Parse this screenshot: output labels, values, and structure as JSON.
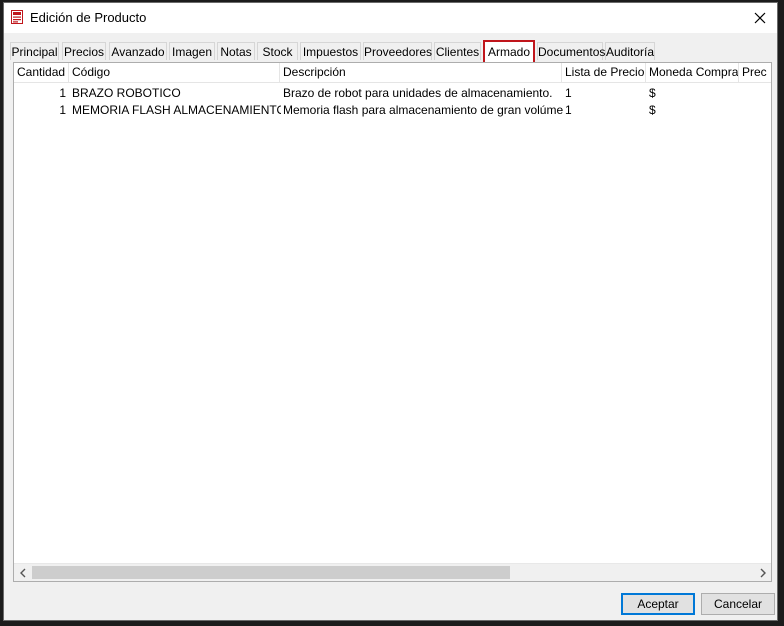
{
  "window": {
    "title": "Edición de Producto",
    "close_glyph": "✕"
  },
  "tabs": [
    {
      "label": "Principal"
    },
    {
      "label": "Precios"
    },
    {
      "label": "Avanzado"
    },
    {
      "label": "Imagen"
    },
    {
      "label": "Notas"
    },
    {
      "label": "Stock"
    },
    {
      "label": "Impuestos"
    },
    {
      "label": "Proveedores"
    },
    {
      "label": "Clientes"
    },
    {
      "label": "Armado",
      "active": true
    },
    {
      "label": "Documentos"
    },
    {
      "label": "Auditoría"
    }
  ],
  "table": {
    "columns": [
      "Cantidad",
      "Código",
      "Descripción",
      "Lista de Precio",
      "Moneda Compra",
      "Prec"
    ],
    "rows": [
      {
        "cantidad": "1",
        "codigo": "BRAZO ROBOTICO",
        "descripcion": "Brazo de robot para unidades de almacenamiento.",
        "lista": "1",
        "moneda": "$"
      },
      {
        "cantidad": "1",
        "codigo": "MEMORIA FLASH ALMACENAMIENTO",
        "descripcion": "Memoria flash para almacenamiento de gran volúmen.",
        "lista": "1",
        "moneda": "$"
      }
    ]
  },
  "scrollbar": {
    "left_arrow": "<",
    "right_arrow": ">"
  },
  "buttons": {
    "accept_label": "Aceptar",
    "cancel_label": "Cancelar"
  },
  "colors": {
    "active_tab_border": "#c0151b",
    "default_button_border": "#0078d7"
  },
  "icons": {
    "app": "product-form-icon",
    "close": "close-icon"
  }
}
